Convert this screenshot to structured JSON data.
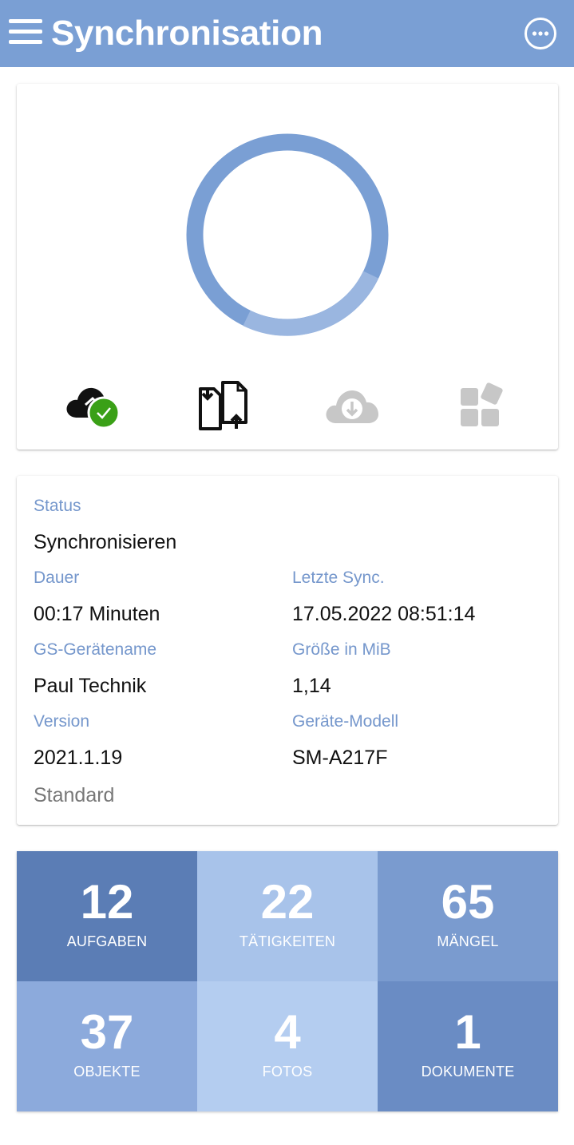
{
  "appbar": {
    "title": "Synchronisation",
    "menu_icon": "hamburger-menu-icon",
    "more_icon": "more-options-icon",
    "color": "#7a9fd4"
  },
  "progress": {
    "color_main": "#7a9fd4",
    "color_highlight": "#9ab6e0"
  },
  "status_icons": [
    {
      "name": "cloud-check-icon",
      "state": "done"
    },
    {
      "name": "file-transfer-icon",
      "state": "active"
    },
    {
      "name": "cloud-download-icon",
      "state": "pending"
    },
    {
      "name": "modules-icon",
      "state": "pending"
    }
  ],
  "info": {
    "status_label": "Status",
    "status_value": "Synchronisieren",
    "duration_label": "Dauer",
    "duration_value": "00:17 Minuten",
    "last_sync_label": "Letzte Sync.",
    "last_sync_value": "17.05.2022 08:51:14",
    "device_name_label": "GS-Gerätename",
    "device_name_value": "Paul Technik",
    "size_label": "Größe in MiB",
    "size_value": "1,14",
    "version_label": "Version",
    "version_value": "2021.1.19",
    "model_label": "Geräte-Modell",
    "model_value": "SM-A217F",
    "edition_value": "Standard"
  },
  "tiles": [
    {
      "count": "12",
      "label": "AUFGABEN",
      "color": "#5b7db5"
    },
    {
      "count": "22",
      "label": "TÄTIGKEITEN",
      "color": "#a8c3ea"
    },
    {
      "count": "65",
      "label": "MÄNGEL",
      "color": "#7a9bcf"
    },
    {
      "count": "37",
      "label": "OBJEKTE",
      "color": "#8caadc"
    },
    {
      "count": "4",
      "label": "FOTOS",
      "color": "#b4cdf0"
    },
    {
      "count": "1",
      "label": "DOKUMENTE",
      "color": "#6a8cc4"
    }
  ],
  "colors": {
    "label_text": "#7597cc",
    "success": "#3aa017",
    "pending_icon": "#c7c7c7"
  }
}
